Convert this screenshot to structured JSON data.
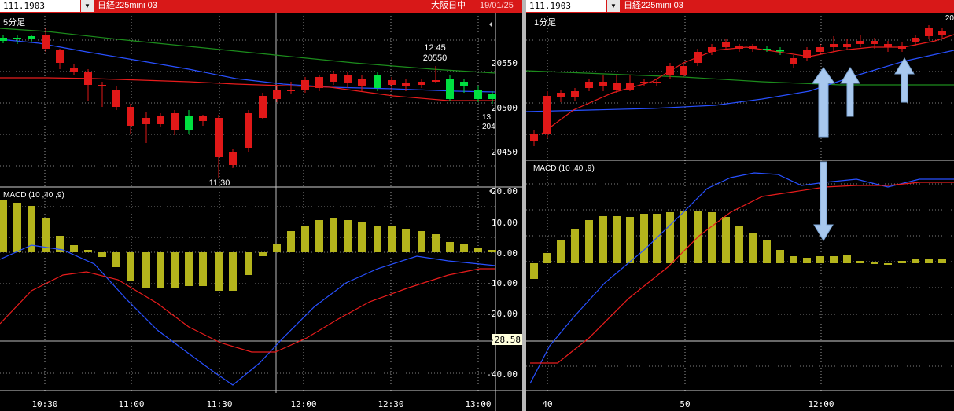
{
  "left_chart": {
    "symbol": "111.1903",
    "instrument": "日経225mini 03",
    "session": "大阪日中",
    "date": "19/01/25",
    "timeframe": "5分足",
    "macd_label": "MACD (10 ,40 ,9)",
    "price_axis": [
      "20550",
      "20500",
      "20450"
    ],
    "macd_axis": [
      "20.00",
      "10.00",
      "0.00",
      "-10.00",
      "-20.00",
      "-40.00"
    ],
    "time_axis": [
      "10:30",
      "11:00",
      "11:30",
      "12:00",
      "12:30",
      "13:00"
    ],
    "annotation_time": "12:45",
    "annotation_price": "20550",
    "low_label": "11:30",
    "edge_label_1": "13:",
    "edge_label_2": "204",
    "macd_cursor_value": "-28.58"
  },
  "right_chart": {
    "symbol": "111.1903",
    "instrument": "日経225mini 03",
    "timeframe": "1分足",
    "macd_label": "MACD (10 ,40 ,9)",
    "edge_label": "20",
    "time_axis": [
      "40",
      "50",
      "12:00"
    ]
  },
  "colors": {
    "bull": "#00e040",
    "bear": "#e01818",
    "macd_hist": "#b4b41c",
    "blue_line": "#2850ff",
    "red_line": "#e81c1c",
    "green_line": "#1c8c1c",
    "grid": "#ffffff",
    "arrow_fill": "#a8c8ee"
  },
  "icons": {
    "dropdown": "chevron-down-icon",
    "scroll": "triangle-left-icon",
    "signal": "up-arrow-icon"
  }
}
